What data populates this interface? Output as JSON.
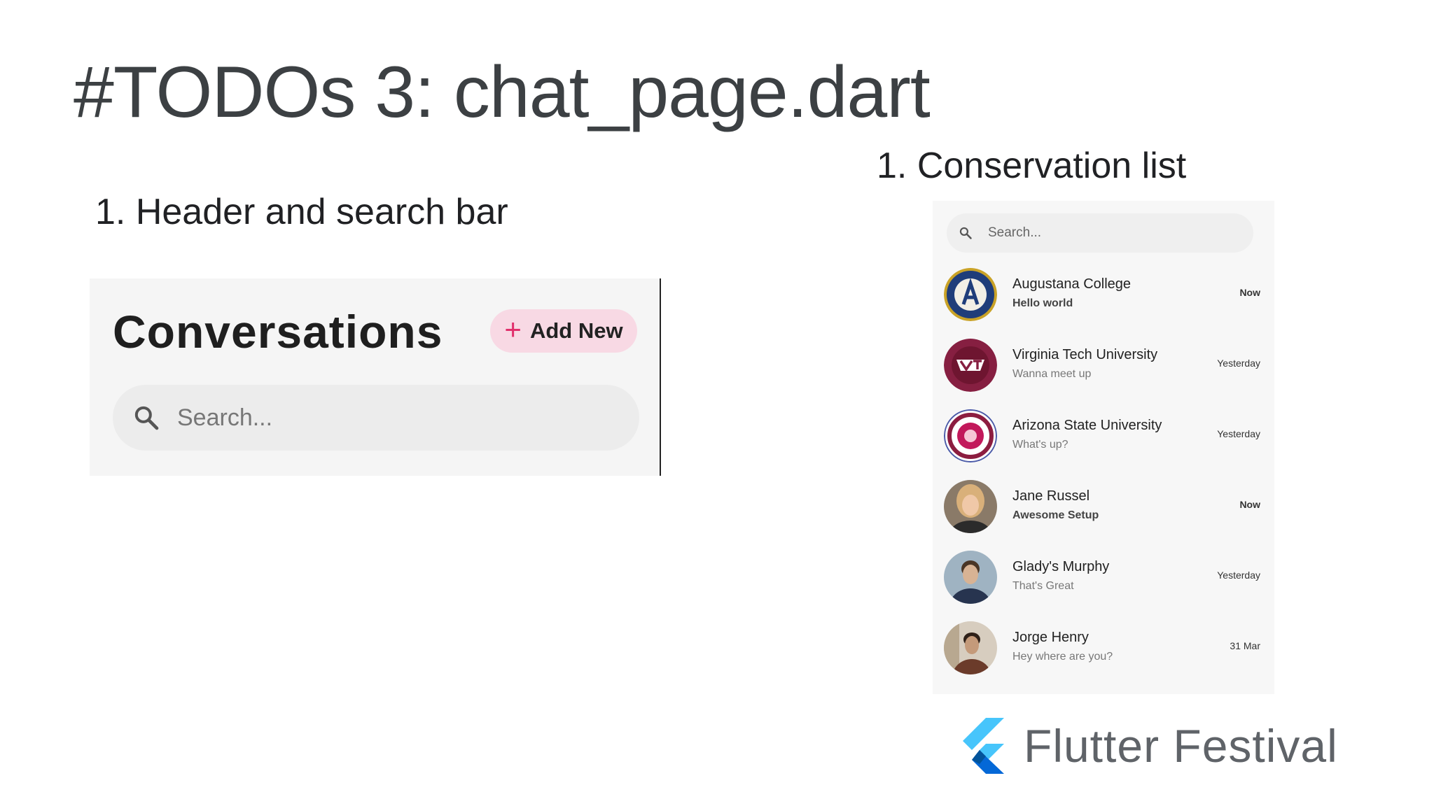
{
  "slide": {
    "title": "#TODOs 3: chat_page.dart",
    "label_left": "1. Header and search bar",
    "label_right": "1. Conservation list"
  },
  "header": {
    "title": "Conversations",
    "add_new_label": "Add New",
    "search_placeholder": "Search..."
  },
  "list": {
    "search_placeholder": "Search...",
    "items": [
      {
        "name": "Augustana College",
        "message": "Hello world",
        "time": "Now",
        "unread": true,
        "avatar": "augustana-seal-icon"
      },
      {
        "name": "Virginia Tech University",
        "message": "Wanna meet up",
        "time": "Yesterday",
        "unread": false,
        "avatar": "virginia-tech-logo-icon"
      },
      {
        "name": "Arizona State University",
        "message": "What's up?",
        "time": "Yesterday",
        "unread": false,
        "avatar": "asu-seal-icon"
      },
      {
        "name": "Jane Russel",
        "message": "Awesome Setup",
        "time": "Now",
        "unread": true,
        "avatar": "person-photo"
      },
      {
        "name": "Glady's Murphy",
        "message": "That's Great",
        "time": "Yesterday",
        "unread": false,
        "avatar": "person-photo"
      },
      {
        "name": "Jorge Henry",
        "message": "Hey where are you?",
        "time": "31 Mar",
        "unread": false,
        "avatar": "person-photo"
      }
    ]
  },
  "footer": {
    "brand": "Flutter Festival"
  },
  "colors": {
    "accent_pink": "#f8d9e4",
    "plus_pink": "#e1306c",
    "flutter_light": "#47c5fb",
    "flutter_dark": "#0468d7"
  }
}
